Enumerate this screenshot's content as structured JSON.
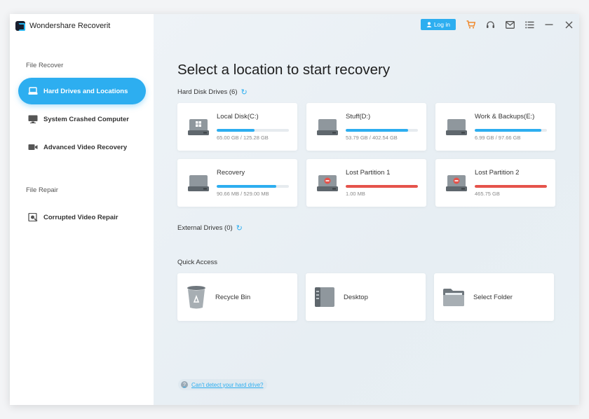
{
  "app": {
    "title": "Wondershare Recoverit"
  },
  "topbar": {
    "login_label": "Log in",
    "icons": [
      "cart-icon",
      "headset-icon",
      "mail-icon",
      "menu-icon",
      "minimize-icon",
      "close-icon"
    ]
  },
  "sidebar": {
    "file_recover_label": "File Recover",
    "file_repair_label": "File Repair",
    "items": [
      {
        "label": "Hard Drives and Locations",
        "icon": "hard-drive-icon",
        "active": true
      },
      {
        "label": "System Crashed Computer",
        "icon": "monitor-icon",
        "active": false
      },
      {
        "label": "Advanced Video Recovery",
        "icon": "video-camera-icon",
        "active": false
      },
      {
        "label": "Corrupted Video Repair",
        "icon": "video-repair-icon",
        "active": false
      }
    ]
  },
  "main": {
    "title": "Select a location to start recovery",
    "hard_disk_label": "Hard Disk Drives (6)",
    "external_label": "External Drives (0)",
    "quick_access_label": "Quick Access",
    "help_link": "Can't detect your hard drive?",
    "drives": [
      {
        "name": "Local Disk(C:)",
        "size": "65.00 GB / 125.28 GB",
        "usage": 0.52,
        "status": "ok",
        "icon": "windows-drive-icon"
      },
      {
        "name": "Stuff(D:)",
        "size": "53.79 GB / 402.54 GB",
        "usage": 0.86,
        "status": "ok",
        "icon": "drive-icon"
      },
      {
        "name": "Work & Backups(E:)",
        "size": "6.99 GB / 97.66 GB",
        "usage": 0.92,
        "status": "ok",
        "icon": "drive-icon"
      },
      {
        "name": "Recovery",
        "size": "90.66 MB / 529.00 MB",
        "usage": 0.83,
        "status": "ok",
        "icon": "drive-icon"
      },
      {
        "name": "Lost Partition 1",
        "size": "1.00 MB",
        "usage": 1.0,
        "status": "lost",
        "icon": "lost-drive-icon"
      },
      {
        "name": "Lost Partition 2",
        "size": "465.75 GB",
        "usage": 1.0,
        "status": "lost",
        "icon": "lost-drive-icon"
      }
    ],
    "quick_access": [
      {
        "label": "Recycle Bin",
        "icon": "recycle-bin-icon"
      },
      {
        "label": "Desktop",
        "icon": "desktop-icon"
      },
      {
        "label": "Select Folder",
        "icon": "folder-icon"
      }
    ]
  },
  "colors": {
    "accent": "#2daef0",
    "lost": "#e5534b",
    "track": "#e6ebef"
  }
}
